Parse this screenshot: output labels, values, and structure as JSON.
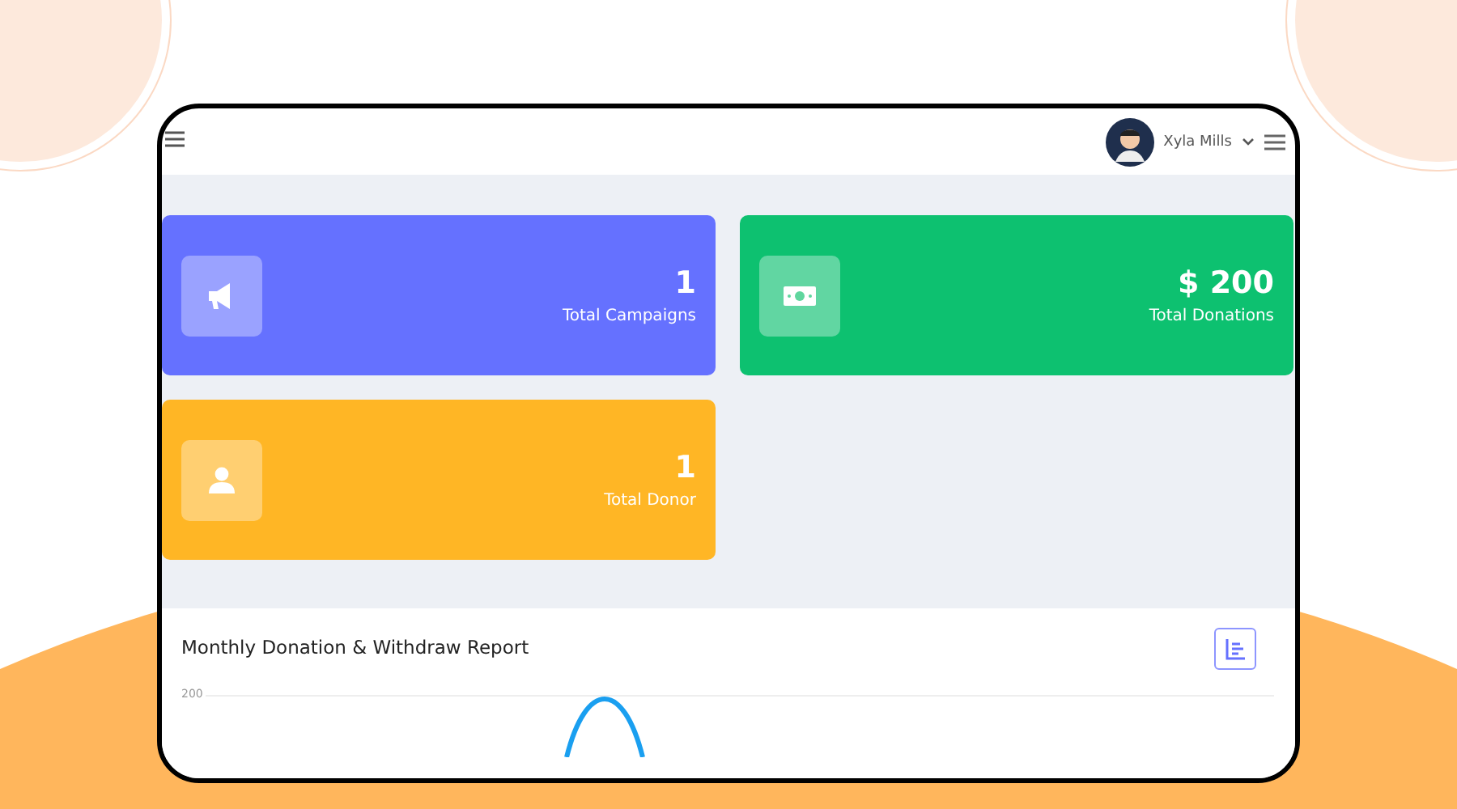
{
  "header": {
    "user": {
      "name": "Xyla Mills"
    }
  },
  "stats": [
    {
      "kind": "megaphone",
      "value": "1",
      "label": "Total Campaigns",
      "color": "#6571ff"
    },
    {
      "kind": "money",
      "value": "$ 200",
      "label": "Total Donations",
      "color": "#0dc170"
    },
    {
      "kind": "user",
      "value": "1",
      "label": "Total Donor",
      "color": "#ffb625"
    }
  ],
  "report": {
    "title": "Monthly Donation & Withdraw Report",
    "y_tick": "200"
  }
}
